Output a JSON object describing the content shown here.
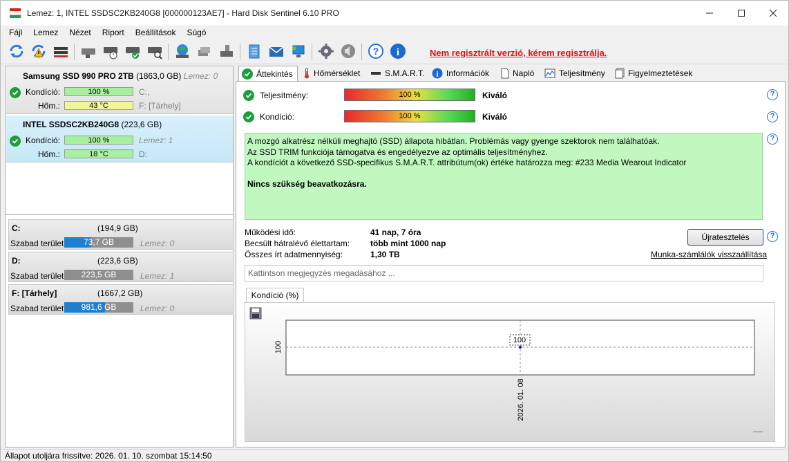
{
  "window": {
    "title": "Lemez: 1, INTEL SSDSC2KB240G8 [000000123AE7]  -  Hard Disk Sentinel 6.10 PRO"
  },
  "menu": [
    "Fájl",
    "Lemez",
    "Nézet",
    "Riport",
    "Beállítások",
    "Súgó"
  ],
  "toolbar": {
    "unregistered": "Nem regisztrált verzió, kérem regisztrálja."
  },
  "disks": [
    {
      "name": "Samsung SSD 990 PRO 2TB",
      "size": "(1863,0 GB)",
      "extra": "Lemez: 0",
      "condition_label": "Kondíció:",
      "condition": "100 %",
      "condition_pct": 100,
      "temp_label": "Hőm.:",
      "temp": "43 °C",
      "side1": "C:,",
      "side2": "F: [Tárhely]"
    },
    {
      "name": "INTEL SSDSC2KB240G8",
      "size": "(223,6 GB)",
      "extra": "",
      "condition_label": "Kondíció:",
      "condition": "100 %",
      "condition_pct": 100,
      "temp_label": "Hőm.:",
      "temp": "18 °C",
      "side1": "Lemez: 1",
      "side2": "D:"
    }
  ],
  "volumes": [
    {
      "name": "C:",
      "size": "(194,9 GB)",
      "free_label": "Szabad terület",
      "free": "73,7 GB",
      "free_pct": 38,
      "color": "#1f7fd0",
      "lemez": "Lemez: 0"
    },
    {
      "name": "D:",
      "size": "(223,6 GB)",
      "free_label": "Szabad terület",
      "free": "223,5 GB",
      "free_pct": 100,
      "color": "#8f8f8f",
      "lemez": "Lemez: 1"
    },
    {
      "name": "F: [Tárhely]",
      "size": "(1667,2 GB)",
      "free_label": "Szabad terület",
      "free": "981,6 GB",
      "free_pct": 59,
      "color": "#1f7fd0",
      "lemez": "Lemez: 0"
    }
  ],
  "tabs": [
    "Áttekintés",
    "Hőmérséklet",
    "S.M.A.R.T.",
    "Információk",
    "Napló",
    "Teljesítmény",
    "Figyelmeztetések"
  ],
  "overview": {
    "performance_label": "Teljesítmény:",
    "performance": "100 %",
    "performance_quality": "Kiváló",
    "condition_label": "Kondíció:",
    "condition": "100 %",
    "condition_quality": "Kiváló",
    "info_lines": [
      "A mozgó alkatrész nélküli meghajtó (SSD) állapota hibátlan. Problémás vagy gyenge szektorok nem találhatóak.",
      "Az SSD TRIM funkciója támogatva és engedélyezve az optimális teljesítményhez.",
      "A kondíciót a következő SSD-specifikus S.M.A.R.T. attribútum(ok) értéke határozza meg:  #233 Media Wearout Indicator"
    ],
    "info_bold": "Nincs szükség beavatkozásra.",
    "uptime_label": "Működési idő:",
    "uptime": "41 nap, 7 óra",
    "remaining_label": "Becsült hátralévő élettartam:",
    "remaining": "több mint 1000 nap",
    "written_label": "Összes írt adatmennyiség:",
    "written": "1,30 TB",
    "retest_button": "Újratesztelés",
    "reset_link": "Munka-számlálók visszaállítása",
    "note_placeholder": "Kattintson megjegyzés megadásához ...",
    "chart_tab": "Kondíció  (%)"
  },
  "chart_data": {
    "type": "line",
    "x": [
      "2026. 01. 08"
    ],
    "series": [
      {
        "values": [
          100
        ]
      }
    ],
    "ylabel": "",
    "xlabel": "",
    "y_tick": "100",
    "point_label": "100",
    "title": ""
  },
  "status": {
    "text": "Állapot utoljára frissítve: 2026. 01. 10. szombat 15:14:50"
  },
  "colors": {
    "selected_card": "#c6e8f6",
    "info_green": "#c0f8c0",
    "unregistered": "#e01010",
    "check_green": "#1f9d3b"
  }
}
